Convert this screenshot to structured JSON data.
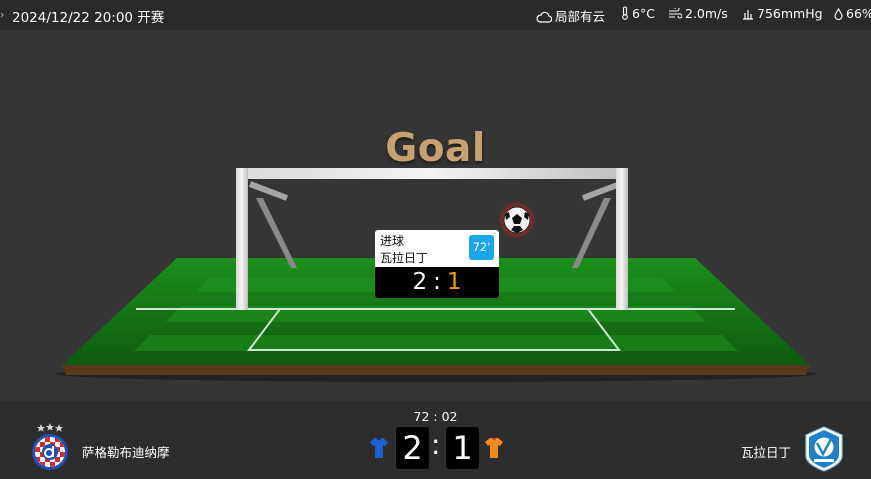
{
  "header": {
    "kickoff": "2024/12/22 20:00 开赛",
    "weather": {
      "condition": "局部有云",
      "temperature": "6°C",
      "wind": "2.0m/s",
      "pressure": "756mmHg",
      "humidity": "66%"
    }
  },
  "animation": {
    "title": "Goal",
    "event": {
      "type": "进球",
      "team": "瓦拉日丁",
      "minute": "72'",
      "home_score": "2",
      "away_score": "1",
      "separator": ":"
    }
  },
  "scoreboard": {
    "clock": "72 : 02",
    "home_team": "萨格勒布迪纳摩",
    "away_team": "瓦拉日丁",
    "home_score": "2",
    "away_score": "1",
    "separator": ":",
    "home_color": "#1f5fd6",
    "away_color": "#f08a1c"
  },
  "colors": {
    "background": "#333333",
    "pitch_green": "#1c9a1c",
    "goal_text": "#c8a173",
    "minute_badge": "#1aa6e8",
    "away_score_highlight": "#f39a1e"
  }
}
